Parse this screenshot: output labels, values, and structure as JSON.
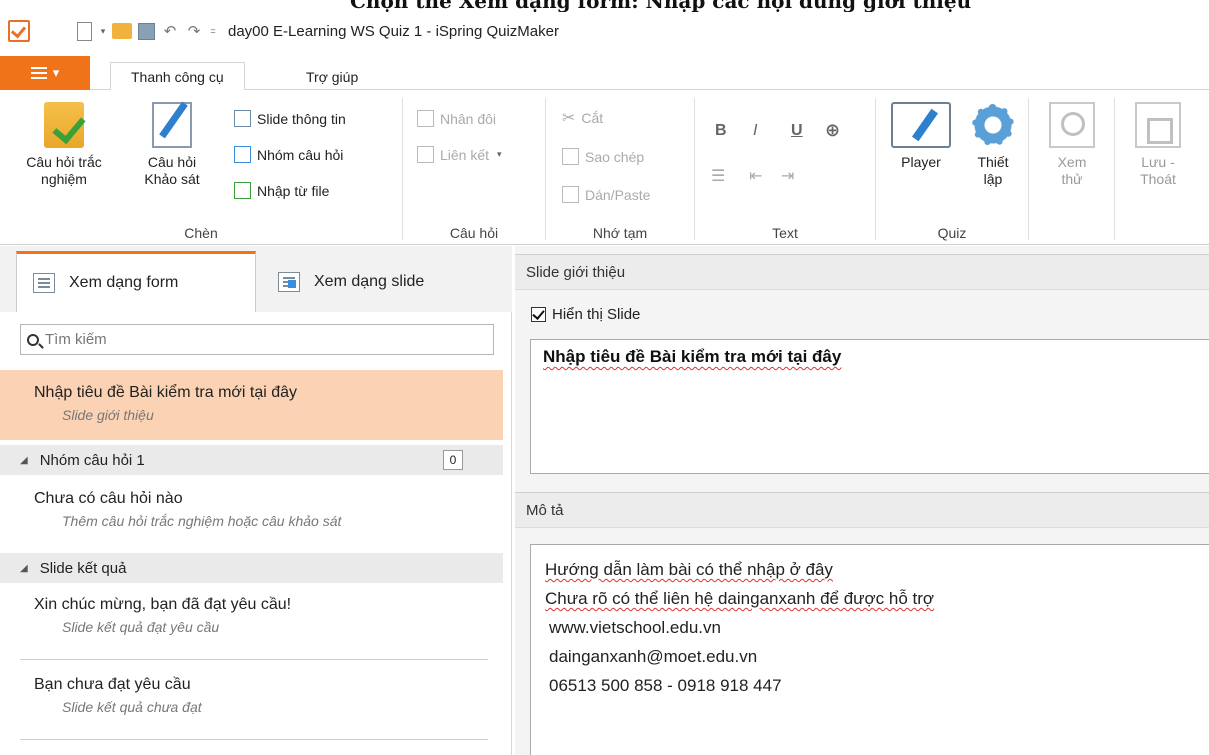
{
  "caption": "Chọn thẻ Xem dạng form: Nhập các nội dung giới thiệu",
  "titlebar": {
    "title": "day00 E-Learning WS Quiz 1 - iSpring QuizMaker",
    "quick_access_more": "="
  },
  "tabs": {
    "file_icon": "menu-icon",
    "active": "Thanh công cụ",
    "help": "Trợ giúp"
  },
  "ribbon": {
    "insert": {
      "label": "Chèn",
      "quiz_question": "Câu hỏi trắc nghiệm",
      "survey_question": "Câu hỏi Khảo sát",
      "info_slide": "Slide thông tin",
      "question_group": "Nhóm câu hỏi",
      "import_file": "Nhập từ file"
    },
    "question": {
      "label": "Câu hỏi",
      "duplicate": "Nhân đôi",
      "link": "Liên kết"
    },
    "clipboard": {
      "label": "Nhớ tạm",
      "cut": "Cắt",
      "copy": "Sao chép",
      "paste": "Dán/Paste"
    },
    "text": {
      "label": "Text",
      "bold": "B",
      "italic": "I",
      "underline": "U"
    },
    "quiz": {
      "label": "Quiz",
      "player": "Player",
      "settings": "Thiết lập"
    },
    "preview": "Xem thử",
    "save_exit": "Lưu - Thoát"
  },
  "left": {
    "view_form": "Xem dạng form",
    "view_slide": "Xem dạng slide",
    "search_placeholder": "Tìm kiếm",
    "intro_title": "Nhập tiêu đề Bài kiểm tra mới tại đây",
    "intro_sub": "Slide giới thiệu",
    "group1": "Nhóm câu hỏi 1",
    "group1_count": "0",
    "empty_title": "Chưa có câu hỏi nào",
    "empty_sub": "Thêm câu hỏi trắc nghiệm hoặc câu khảo sát",
    "results": "Slide kết quả",
    "pass_title": "Xin chúc mừng, bạn đã đạt yêu cầu!",
    "pass_sub": "Slide kết quả đạt yêu cầu",
    "fail_title": "Bạn chưa đạt yêu cầu",
    "fail_sub": "Slide kết quả chưa đạt"
  },
  "right": {
    "intro_header": "Slide giới thiệu",
    "show_slide": "Hiển thị Slide",
    "title_value": "Nhập tiêu đề Bài kiểm tra mới tại đây",
    "desc_header": "Mô tả",
    "desc_lines": [
      "Hướng dẫn làm bài có thể nhập ở đây",
      "Chưa rõ có thể liên hệ dainganxanh để được hỗ trợ",
      " www.vietschool.edu.vn",
      " dainganxanh@moet.edu.vn",
      " 06513 500 858 - 0918 918 447"
    ]
  }
}
